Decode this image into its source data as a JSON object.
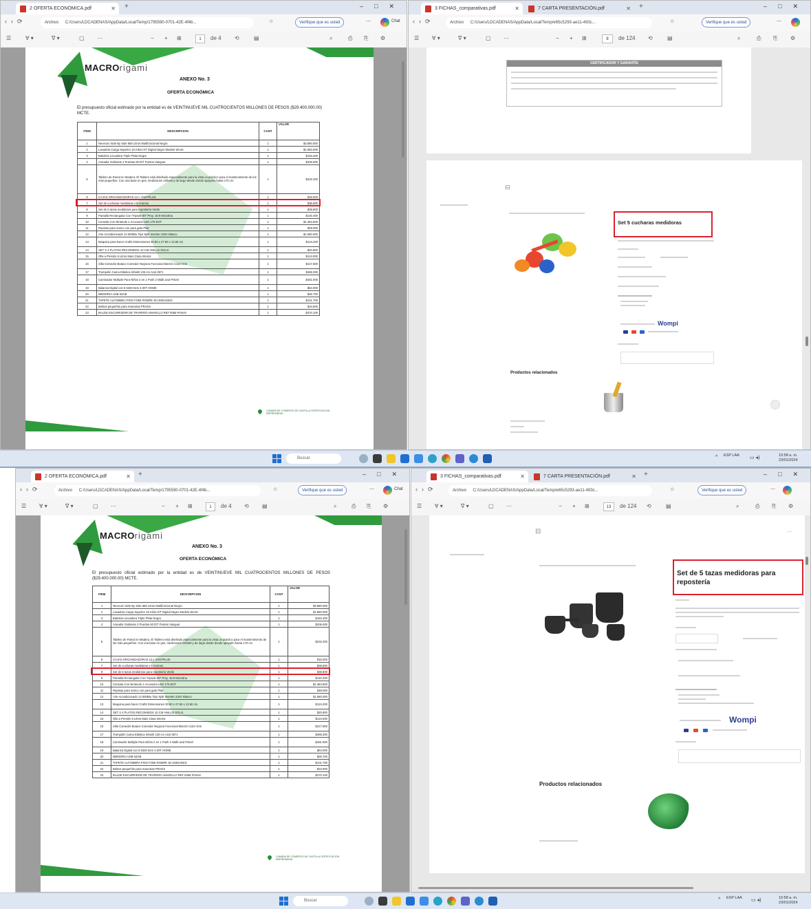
{
  "top": {
    "left_window": {
      "tab_title": "2 OFERTA ECONÓMICA.pdf",
      "address_scheme": "Archivo",
      "address_path": "C:/Users/LDCADENAS/AppData/Local/Temp/1795590-0701-42E-4f4b...",
      "verify_label": "Verifique que es usted",
      "copilot_label": "Chat",
      "page_number": "1",
      "page_count": "de 4",
      "document": {
        "logo_strong": "MACRO",
        "logo_light": "rigami",
        "annex_title": "ANEXO No. 3",
        "offer_title": "OFERTA ECONÓMICA",
        "budget_text": "El presupuesto oficial estimado por la entidad es de VEINTINUEVE MIL CUATROCIENTOS MILLONES DE PESOS ($29.400.000.00) MCTE.",
        "headers": {
          "item": "ITEM",
          "description": "DESCRIPCION",
          "qty": "CANT",
          "value": "VALOR"
        },
        "rows": [
          {
            "item": "1",
            "desc": "Nevecon Side By Side 660 Litros Multifuncional Negro",
            "qty": "1",
            "value": "$3.680.000"
          },
          {
            "item": "2",
            "desc": "Lavadora Carga Superior 16 Kilos H/T Digital Negro Modelo WA16",
            "qty": "1",
            "value": "$1.850.000"
          },
          {
            "item": "3",
            "desc": "Batidora Licuadora Triple Plata Negra",
            "qty": "1",
            "value": "$184.400"
          },
          {
            "item": "4",
            "desc": "Aireador Gabinete 2 Puertas 60 D/T Puntos Vanguar",
            "qty": "1",
            "value": "$206.000"
          },
          {
            "item": "5",
            "desc": "Tablero de Pared en Madera. El Tablero está diseñado especialmente para la vista un práctico para el mantenimiento de los más pequeños. Con una base en gris, mediciones 100x60 y de largo desde donde apoyarlo hasta 170 cm",
            "qty": "1",
            "value": "$232.200"
          },
          {
            "item": "6",
            "desc": "CAJAS ORGANIZADORAS 12 L VANTPLUS",
            "qty": "1",
            "value": "$15.000"
          },
          {
            "item": "7",
            "desc": "Set de cucharas medidoras x 5 Aromos",
            "qty": "1",
            "value": "$36.800"
          },
          {
            "item": "8",
            "desc": "Set de 5 tazas medidoras para repostería Verde",
            "qty": "1",
            "value": "$38.800"
          },
          {
            "item": "9",
            "desc": "Pantalla Rectangular Con Tripode 80\" Proy. 16:9 Microlina",
            "qty": "1",
            "value": "$140.400"
          },
          {
            "item": "10",
            "desc": "Consola Con Nintendo 1 Accesorio LED 175 EOT",
            "qty": "1",
            "value": "$1.484.500"
          },
          {
            "item": "11",
            "desc": "Repisas para marco con para gato Pilar",
            "qty": "1",
            "value": "$48.000"
          },
          {
            "item": "12",
            "desc": "Aire Acondicionado 12.000Btu Tipo Split Inverter 220V Blanco",
            "qty": "1",
            "value": "$1.580.000"
          },
          {
            "item": "13",
            "desc": "Maquina para hacer Crafts Dimensiones 30.50 x 27.50 x 13.50 cm",
            "qty": "1",
            "value": "$124.200"
          },
          {
            "item": "14",
            "desc": "SET X 4 PLATOS RECOMIDOS 10 CM ANILLO SOLIA",
            "qty": "1",
            "value": "$20.800"
          },
          {
            "item": "15",
            "desc": "Olla a Presión 6 Litros Mani Clara Interior",
            "qty": "1",
            "value": "$124.000"
          },
          {
            "item": "16",
            "desc": "Silla Comedor Butaco Comedor Negrura Funcional Marrón Color Gris",
            "qty": "1",
            "value": "$417.600"
          },
          {
            "item": "17",
            "desc": "Trampolin Cama Elástica Infantil 125 cm Azul 3571",
            "qty": "1",
            "value": "$468.300"
          },
          {
            "item": "18",
            "desc": "Caminador Multiple Para Niños 2 en 1 Push 2 Walk azul Pritvel",
            "qty": "1",
            "value": "$481.000"
          },
          {
            "item": "19",
            "desc": "Balanza Digital con 6 5320 Item 4.00T HOME",
            "qty": "1",
            "value": "$64.000"
          },
          {
            "item": "20",
            "desc": "MEMORIA USB 64GB",
            "qty": "1",
            "value": "$26.700"
          },
          {
            "item": "21",
            "desc": "TAPETE ALFOMBRA PISO FOMI ROMPE 30 UNIDADES",
            "qty": "1",
            "value": "$101.700"
          },
          {
            "item": "22",
            "desc": "Bolsos pequeños para mascotas PRAKS",
            "qty": "1",
            "value": "$34.500"
          },
          {
            "item": "23",
            "desc": "BALDE ESCURRIDOR DE TRAPERO AMARILLO REF 5068 PANAV",
            "qty": "1",
            "value": "$270.100"
          }
        ],
        "footer_text": "CAMARA DE COMERCIO DE CASTILLA CERTIFICACION EMPRESARIAL",
        "highlight_row": 6
      }
    },
    "right_window": {
      "tab1_title": "3 FICHAS_comparativas.pdf",
      "tab2_title": "7 CARTA PRESENTACIÓN.pdf",
      "address_scheme": "Archivo",
      "address_path": "C:/Users/LDCADENAS/AppData/Local/Temp/e65c5293-ae11-493c...",
      "verify_label": "Verifique que es usted",
      "page_number": "8",
      "page_count": "de 124",
      "cert_header": "CERTIFICADOR Y GARANTÍA",
      "product_title": "Set 5 cucharas medidoras",
      "related_label": "Productos relacionados",
      "wompi_label": "Wompi"
    },
    "taskbar": {
      "search_label": "Buscar",
      "time": "10:58 a. m.",
      "date": "23/01/2024",
      "lang": "ESP LAA"
    }
  },
  "bottom": {
    "left_window": {
      "tab_title": "2 OFERTA ECONÓMICA.pdf",
      "address_scheme": "Archivo",
      "address_path": "C:/Users/LDCADENAS/AppData/Local/Temp/1795590-0701-42E-4f4b...",
      "verify_label": "Verifique que es usted",
      "copilot_label": "Chat",
      "page_number": "1",
      "page_count": "de 4",
      "highlight_row": 7
    },
    "right_window": {
      "tab1_title": "3 FICHAS_comparativas.pdf",
      "tab2_title": "7 CARTA PRESENTACIÓN.pdf",
      "address_scheme": "Archivo",
      "address_path": "C:/Users/LDCADENAS/AppData/Local/Temp/e65c5293-ae11-493c...",
      "verify_label": "Verifique que es usted",
      "page_number": "13",
      "page_count": "de 124",
      "product_title": "Set de 5 tazas medidoras para repostería",
      "related_label": "Productos relacionados",
      "wompi_label": "Wompi"
    },
    "taskbar": {
      "search_label": "Buscar",
      "time": "10:58 a. m.",
      "date": "23/01/2024",
      "lang": "ESP LAA"
    }
  },
  "colors": {
    "highlight": "#d9212b",
    "brand_green": "#2f9a3e",
    "wompi": "#2c3e8f",
    "tab_bar": "#dfe5ee"
  }
}
